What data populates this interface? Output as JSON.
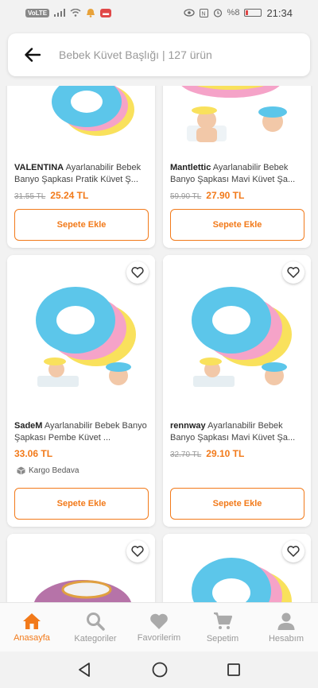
{
  "status_bar": {
    "chip_left": "VoLTE",
    "time": "21:34",
    "battery": "%8"
  },
  "search": {
    "placeholder": "Bebek Küvet Başlığı | 127 ürün"
  },
  "products": [
    {
      "brand": "VALENTINA",
      "name": " Ayarlanabilir Bebek Banyo Şapkası Pratik Küvet Ş...",
      "old_price": "31.55 TL",
      "price": "25.24 TL",
      "cargo": "",
      "button": "Sepete Ekle"
    },
    {
      "brand": "Mantlettic",
      "name": " Ayarlanabilir Bebek Banyo Şapkası Mavi Küvet Şa...",
      "old_price": "59.90 TL",
      "price": "27.90 TL",
      "cargo": "",
      "button": "Sepete Ekle"
    },
    {
      "brand": "SadeM",
      "name": " Ayarlanabilir Bebek Banyo Şapkası Pembe Küvet ...",
      "old_price": "",
      "price": "33.06 TL",
      "cargo": "Kargo Bedava",
      "button": "Sepete Ekle"
    },
    {
      "brand": "rennway",
      "name": " Ayarlanabilir Bebek Banyo Şapkası Mavi Küvet Şa...",
      "old_price": "32.70 TL",
      "price": "29.10 TL",
      "cargo": "",
      "button": "Sepete Ekle"
    }
  ],
  "bottom_nav": [
    {
      "label": "Anasayfa",
      "icon": "home-icon",
      "active": true
    },
    {
      "label": "Kategoriler",
      "icon": "search-icon",
      "active": false
    },
    {
      "label": "Favorilerim",
      "icon": "heart-icon",
      "active": false
    },
    {
      "label": "Sepetim",
      "icon": "cart-icon",
      "active": false
    },
    {
      "label": "Hesabım",
      "icon": "person-icon",
      "active": false
    }
  ],
  "colors": {
    "accent": "#f27a1a",
    "cap_blue": "#5cc6ea",
    "cap_yellow": "#f9e15c",
    "cap_pink": "#f5a3c8",
    "cap_purple": "#b673a8"
  }
}
